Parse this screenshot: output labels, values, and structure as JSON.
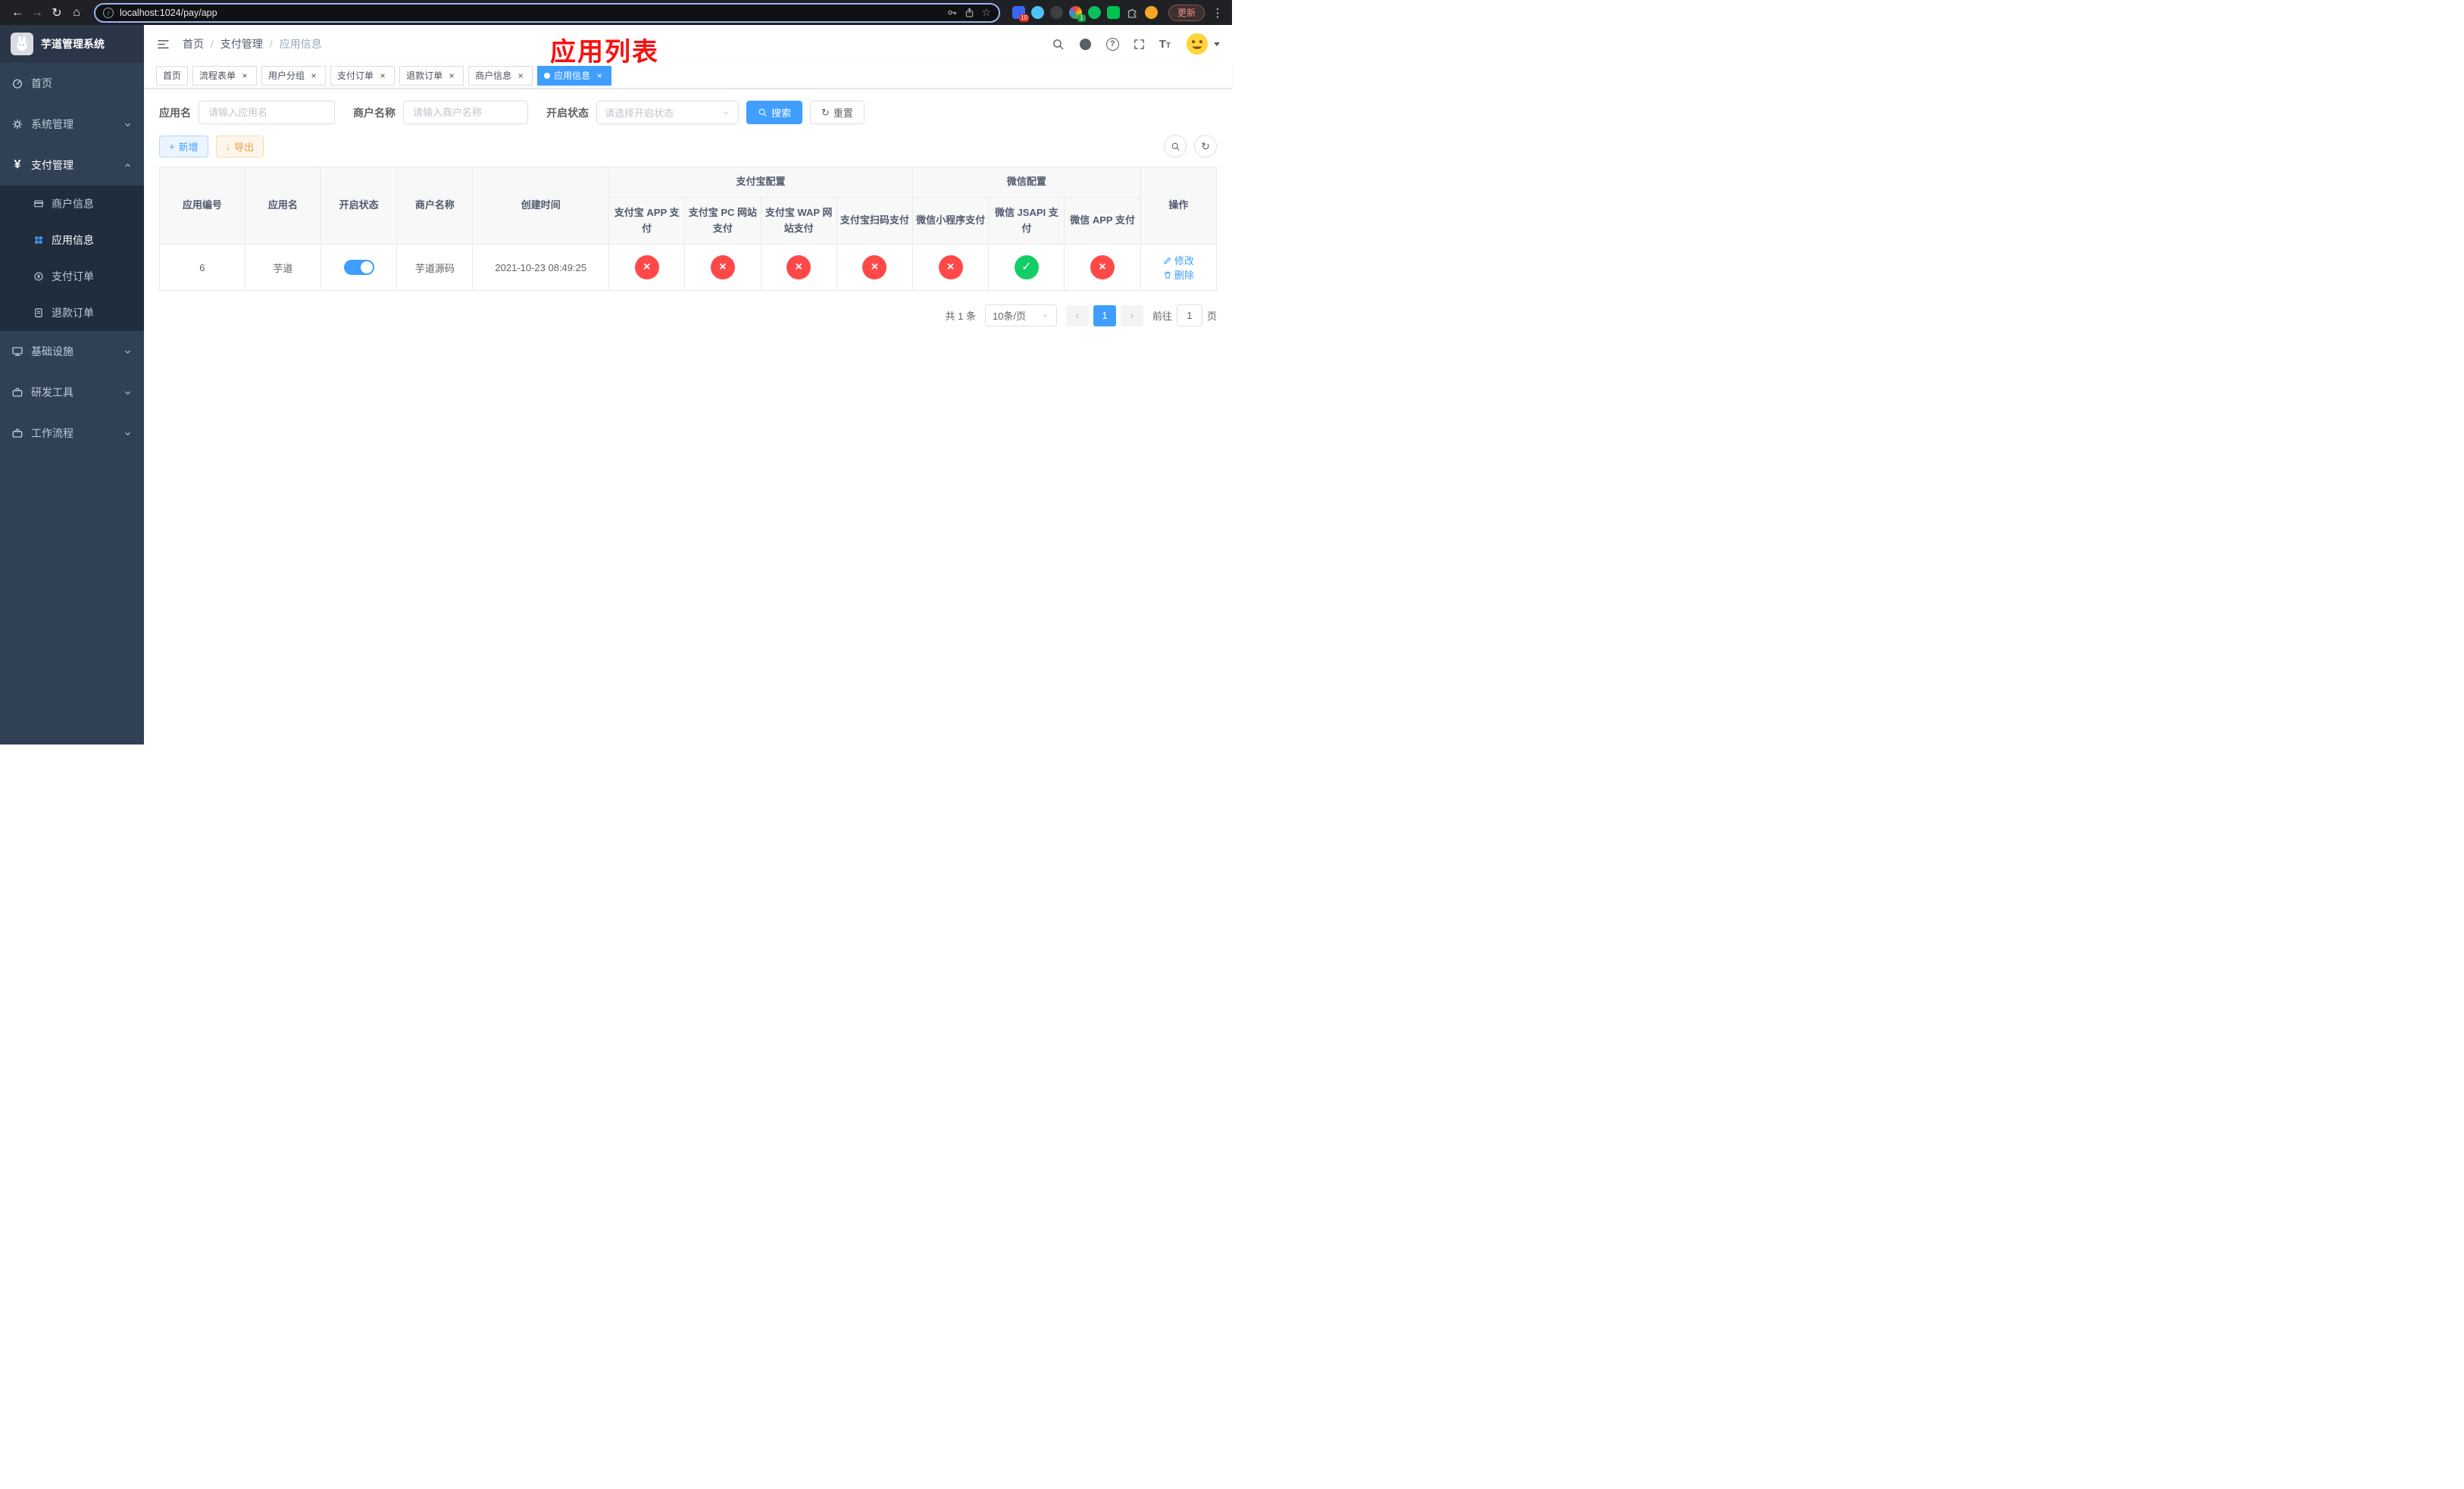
{
  "colors": {
    "accent": "#409eff",
    "danger": "#ff4949",
    "success": "#13ce66",
    "warning": "#e6a23c",
    "sidebar_bg": "#304156",
    "submenu_bg": "#1f2d3d",
    "browser_bg": "#202124",
    "title_red": "#fb0f0f"
  },
  "browser": {
    "url": "localhost:1024/pay/app",
    "update_label": "更新",
    "ext_badge_red": "10",
    "ext_badge_green": "1"
  },
  "icons": {
    "back": "←",
    "forward": "→",
    "reload": "↻",
    "home": "⌂",
    "info": "i",
    "star": "☆",
    "dots": "⋮",
    "cross": "×",
    "check": "✓",
    "plus": "+",
    "download": "↓",
    "question": "?",
    "prev": "‹",
    "next": "›",
    "yen": "¥",
    "font_size": "T"
  },
  "sidebar": {
    "title": "芋道管理系统",
    "items": [
      {
        "label": "首页"
      },
      {
        "label": "系统管理"
      },
      {
        "label": "支付管理"
      },
      {
        "label": "基础设施"
      },
      {
        "label": "研发工具"
      },
      {
        "label": "工作流程"
      }
    ],
    "payment_children": [
      {
        "label": "商户信息"
      },
      {
        "label": "应用信息"
      },
      {
        "label": "支付订单"
      },
      {
        "label": "退款订单"
      }
    ]
  },
  "header": {
    "breadcrumb": [
      "首页",
      "支付管理",
      "应用信息"
    ],
    "separator": "/",
    "overlay_title": "应用列表"
  },
  "tabs": [
    {
      "label": "首页"
    },
    {
      "label": "流程表单"
    },
    {
      "label": "用户分组"
    },
    {
      "label": "支付订单"
    },
    {
      "label": "退款订单"
    },
    {
      "label": "商户信息"
    },
    {
      "label": "应用信息"
    }
  ],
  "filters": {
    "app_name_label": "应用名",
    "app_name_placeholder": "请输入应用名",
    "merchant_label": "商户名称",
    "merchant_placeholder": "请输入商户名称",
    "status_label": "开启状态",
    "status_placeholder": "请选择开启状态",
    "search_label": "搜索",
    "reset_label": "重置"
  },
  "toolbar": {
    "add_label": "新增",
    "export_label": "导出"
  },
  "table": {
    "columns": {
      "app_id": "应用编号",
      "app_name": "应用名",
      "status": "开启状态",
      "merchant": "商户名称",
      "created": "创建时间",
      "alipay_group": "支付宝配置",
      "alipay_app": "支付宝 APP 支付",
      "alipay_pc": "支付宝 PC 网站支付",
      "alipay_wap": "支付宝 WAP 网站支付",
      "alipay_qr": "支付宝扫码支付",
      "wx_group": "微信配置",
      "wx_lite": "微信小程序支付",
      "wx_jsapi": "微信 JSAPI 支付",
      "wx_app": "微信 APP 支付",
      "actions": "操作"
    },
    "rows": [
      {
        "app_id": "6",
        "app_name": "芋道",
        "enabled": true,
        "merchant": "芋道源码",
        "created_at": "2021-10-23 08:49:25",
        "alipay_app": false,
        "alipay_pc": false,
        "alipay_wap": false,
        "alipay_qr": false,
        "wx_lite": false,
        "wx_jsapi": true,
        "wx_app": false,
        "edit_label": "修改",
        "delete_label": "删除"
      }
    ]
  },
  "pagination": {
    "total_text": "共 1 条",
    "page_size_label": "10条/页",
    "page": "1",
    "goto_label": "前往",
    "goto_value": "1",
    "unit_label": "页"
  }
}
